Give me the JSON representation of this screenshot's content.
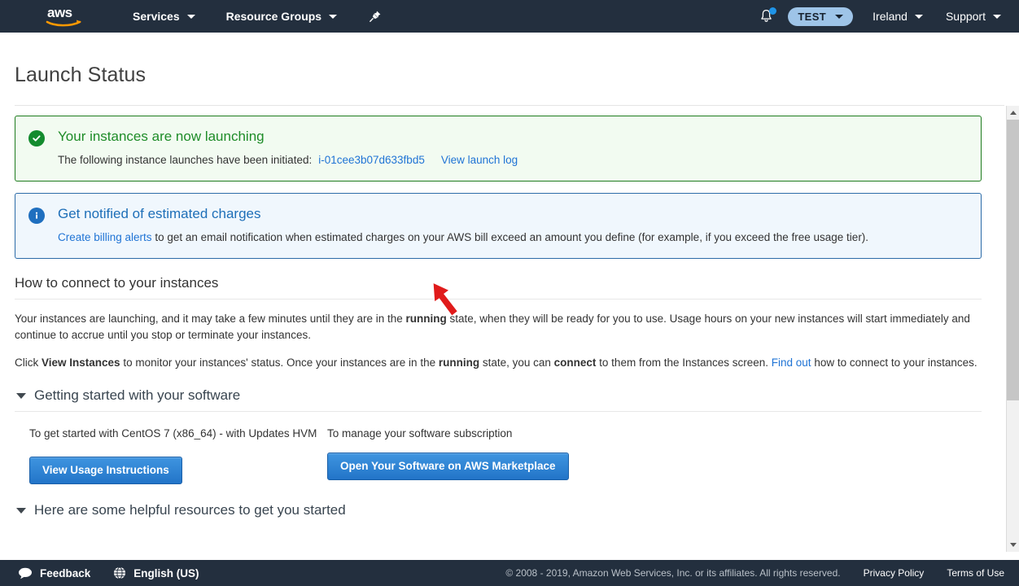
{
  "header": {
    "logo_alt": "aws",
    "services_label": "Services",
    "resource_groups_label": "Resource Groups",
    "pin_icon": "pin-icon",
    "bell_icon": "bell-icon",
    "account_label": "TEST",
    "region_label": "Ireland",
    "support_label": "Support"
  },
  "page": {
    "title": "Launch Status"
  },
  "success_alert": {
    "icon": "check-circle-icon",
    "title": "Your instances are now launching",
    "description": "The following instance launches have been initiated:",
    "instance_id": "i-01cee3b07d633fbd5",
    "launch_log_link": "View launch log"
  },
  "info_alert": {
    "icon": "info-circle-icon",
    "title": "Get notified of estimated charges",
    "link_text": "Create billing alerts",
    "description": " to get an email notification when estimated charges on your AWS bill exceed an amount you define (for example, if you exceed the free usage tier)."
  },
  "connect_section": {
    "heading": "How to connect to your instances",
    "para1_a": "Your instances are launching, and it may take a few minutes until they are in the ",
    "para1_b": "running",
    "para1_c": " state, when they will be ready for you to use. Usage hours on your new instances will start immediately and continue to accrue until you stop or terminate your instances.",
    "para2_a": "Click ",
    "para2_b": "View Instances",
    "para2_c": " to monitor your instances' status. Once your instances are in the ",
    "para2_d": "running",
    "para2_e": " state, you can ",
    "para2_f": "connect",
    "para2_g": " to them from the Instances screen. ",
    "para2_link": "Find out",
    "para2_h": " how to connect to your instances."
  },
  "software_section": {
    "heading": "Getting started with your software",
    "col1_label": "To get started with CentOS 7 (x86_64) - with Updates HVM",
    "col1_button": "View Usage Instructions",
    "col2_label": "To manage your software subscription",
    "col2_button": "Open Your Software on AWS Marketplace"
  },
  "resources_section": {
    "heading": "Here are some helpful resources to get you started"
  },
  "scrollbar": {
    "up_arrow": "scroll-up-arrow",
    "down_arrow": "scroll-down-arrow"
  },
  "cursor": {
    "annotation": "red-arrow-pointer"
  },
  "footer": {
    "feedback_label": "Feedback",
    "feedback_icon": "speech-bubble-icon",
    "language_label": "English (US)",
    "language_icon": "globe-icon",
    "copyright": "© 2008 - 2019, Amazon Web Services, Inc. or its affiliates. All rights reserved.",
    "privacy_label": "Privacy Policy",
    "terms_label": "Terms of Use"
  },
  "colors": {
    "nav_bg": "#232f3e",
    "link": "#2074d5",
    "success_green": "#1e8c28",
    "info_blue": "#1e6fb8",
    "button_blue": "#2274c8",
    "account_pill": "#9ec4e8"
  }
}
